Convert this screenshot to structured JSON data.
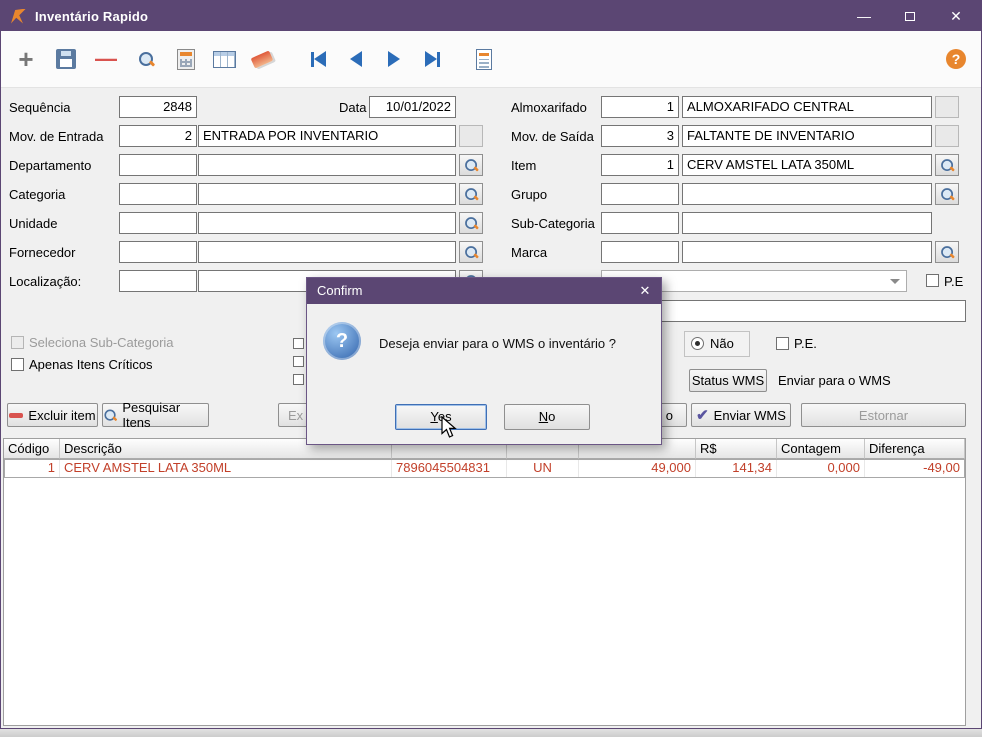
{
  "window": {
    "title": "Inventário Rapido",
    "minimize_glyph": "—",
    "close_glyph": "✕"
  },
  "desktop_fragment": "E",
  "toolbar": {
    "plus_glyph": "+",
    "minus_glyph": "—",
    "help_glyph": "?"
  },
  "form": {
    "rows": {
      "sequencia": {
        "label": "Sequência",
        "value": "2848"
      },
      "data": {
        "label": "Data",
        "value": "10/01/2022"
      },
      "almoxarifado": {
        "label": "Almoxarifado",
        "code": "1",
        "name": "ALMOXARIFADO CENTRAL"
      },
      "mov_entrada": {
        "label": "Mov. de Entrada",
        "code": "2",
        "name": "ENTRADA POR INVENTARIO"
      },
      "mov_saida": {
        "label": "Mov. de Saída",
        "code": "3",
        "name": "FALTANTE DE INVENTARIO"
      },
      "departamento": {
        "label": "Departamento",
        "code": "",
        "name": ""
      },
      "item": {
        "label": "Item",
        "code": "1",
        "name": "CERV AMSTEL LATA 350ML"
      },
      "categoria": {
        "label": "Categoria",
        "code": "",
        "name": ""
      },
      "grupo": {
        "label": "Grupo",
        "code": "",
        "name": ""
      },
      "unidade": {
        "label": "Unidade",
        "code": "",
        "name": ""
      },
      "sub_categoria": {
        "label": "Sub-Categoria",
        "code": "",
        "name": ""
      },
      "fornecedor": {
        "label": "Fornecedor",
        "code": "",
        "name": ""
      },
      "marca": {
        "label": "Marca",
        "code": "",
        "name": ""
      },
      "localizacao": {
        "label": "Localização:",
        "code": "",
        "name": ""
      }
    },
    "pe_combo_label": "P.E",
    "wide_field_value": ""
  },
  "options": {
    "seleciona_sub_categoria": "Seleciona Sub-Categoria",
    "apenas_itens_criticos": "Apenas Itens Críticos",
    "radio_nao": "Não",
    "pe": "P.E.",
    "status_wms": "Status WMS",
    "enviar_para_wms": "Enviar para o WMS"
  },
  "actions": {
    "excluir_item": "Excluir item",
    "pesquisar_itens": "Pesquisar Itens",
    "partial_left": "Ex",
    "partial_right": "o",
    "enviar_wms": "Enviar WMS",
    "estornar": "Estornar"
  },
  "grid": {
    "headers": [
      "Código",
      "Descrição",
      "",
      "",
      "",
      "R$",
      "Contagem",
      "Diferença"
    ],
    "row": {
      "codigo": "1",
      "descricao": "CERV AMSTEL LATA 350ML",
      "barcode": "7896045504831",
      "unidade": "UN",
      "quantidade": "49,000",
      "valor": "141,34",
      "contagem": "0,000",
      "diferenca": "-49,00"
    }
  },
  "dialog": {
    "title": "Confirm",
    "close": "✕",
    "icon": "?",
    "message": "Deseja enviar para o WMS o inventário ?",
    "yes": "Yes",
    "no": "No"
  },
  "colors": {
    "titlebar_purple": "#5b4673",
    "accent_orange": "#e8862e",
    "nav_blue": "#2b6cb8",
    "grid_row_red": "#c2402a"
  }
}
